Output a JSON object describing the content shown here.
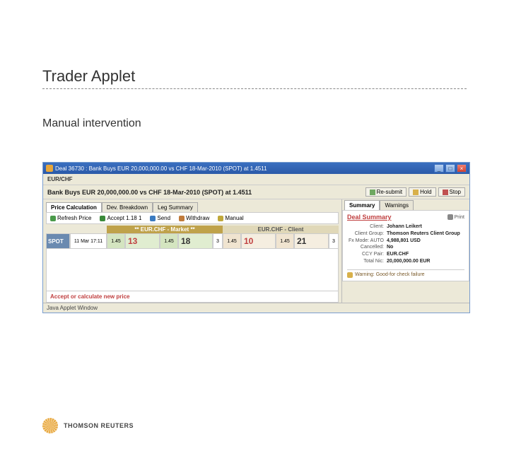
{
  "page": {
    "title": "Trader Applet",
    "subtitle": "Manual intervention"
  },
  "window": {
    "title": "Deal 36730 : Bank Buys EUR 20,000,000.00 vs CHF 18-Mar-2010 (SPOT) at 1.4511",
    "ccy_label": "EUR/CHF",
    "headline": "Bank Buys EUR 20,000,000.00 vs CHF 18-Mar-2010 (SPOT) at 1.4511",
    "actions": {
      "resubmit": "Re-submit",
      "hold": "Hold",
      "stop": "Stop"
    }
  },
  "left": {
    "tabs": [
      "Price Calculation",
      "Dev. Breakdown",
      "Leg Summary"
    ],
    "toolbar": {
      "refresh": "Refresh Price",
      "accept": "Accept 1.18 1",
      "send": "Send",
      "withdraw": "Withdraw",
      "manual": "Manual"
    },
    "grid": {
      "group_market": "** EUR.CHF - Market **",
      "group_client": "EUR.CHF - Client",
      "row_label": "SPOT",
      "row_time": "11 Mar 17:11",
      "market": {
        "bid_sm": "1.45",
        "bid_lg": "13",
        "ask_sm": "1.45",
        "ask_lg": "18",
        "ex": "3"
      },
      "client": {
        "bid_sm": "1.45",
        "bid_lg": "10",
        "ask_sm": "1.45",
        "ask_lg": "21",
        "ex": "3"
      }
    },
    "status": "Accept or calculate new price"
  },
  "right": {
    "tabs": [
      "Summary",
      "Warnings"
    ],
    "print": "Print",
    "deal_summary": "Deal Summary",
    "rows": {
      "client_k": "Client:",
      "client_v": "Johann Leikert",
      "clientgrp_k": "Client Group:",
      "clientgrp_v": "Thomson Reuters Client Group",
      "fx_k": "Fx Mode: AUTO",
      "fx_v": "4,988,801 USD",
      "cancel_k": "Cancelled:",
      "cancel_v": "No",
      "ccy_k": "CCY Pair:",
      "ccy_v": "EUR.CHF",
      "total_k": "Total Nic:",
      "total_v": "20,000,000.00 EUR"
    },
    "warning": "Warning: Good-for check failure"
  },
  "footer": {
    "applet": "Java Applet Window"
  },
  "brand": {
    "name": "THOMSON REUTERS"
  }
}
